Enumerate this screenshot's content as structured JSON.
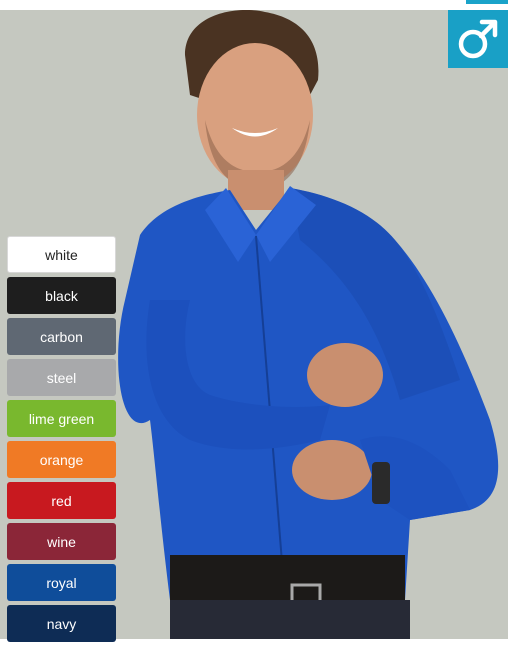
{
  "badge": {
    "icon": "male-symbol-icon",
    "color": "#19a0c6"
  },
  "colors": [
    {
      "id": "white",
      "label": "white",
      "hex": "#ffffff"
    },
    {
      "id": "black",
      "label": "black",
      "hex": "#1e1e1e"
    },
    {
      "id": "carbon",
      "label": "carbon",
      "hex": "#5f6873"
    },
    {
      "id": "steel",
      "label": "steel",
      "hex": "#a8a9ab"
    },
    {
      "id": "lime-green",
      "label": "lime green",
      "hex": "#79b82e"
    },
    {
      "id": "orange",
      "label": "orange",
      "hex": "#f07a25"
    },
    {
      "id": "red",
      "label": "red",
      "hex": "#c8191f"
    },
    {
      "id": "wine",
      "label": "wine",
      "hex": "#8b2638"
    },
    {
      "id": "royal",
      "label": "royal",
      "hex": "#0f4d9a"
    },
    {
      "id": "navy",
      "label": "navy",
      "hex": "#0e2c55"
    }
  ]
}
